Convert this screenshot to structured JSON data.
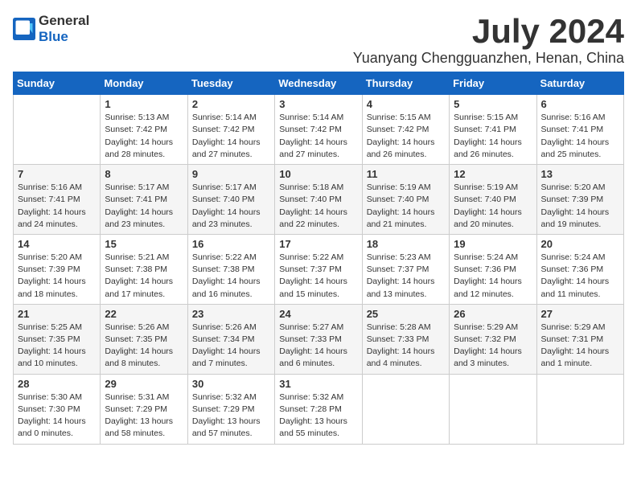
{
  "logo": {
    "general": "General",
    "blue": "Blue"
  },
  "title": "July 2024",
  "subtitle": "Yuanyang Chengguanzhen, Henan, China",
  "weekdays": [
    "Sunday",
    "Monday",
    "Tuesday",
    "Wednesday",
    "Thursday",
    "Friday",
    "Saturday"
  ],
  "weeks": [
    [
      {
        "day": "",
        "sunrise": "",
        "sunset": "",
        "daylight": ""
      },
      {
        "day": "1",
        "sunrise": "5:13 AM",
        "sunset": "7:42 PM",
        "daylight": "14 hours and 28 minutes."
      },
      {
        "day": "2",
        "sunrise": "5:14 AM",
        "sunset": "7:42 PM",
        "daylight": "14 hours and 27 minutes."
      },
      {
        "day": "3",
        "sunrise": "5:14 AM",
        "sunset": "7:42 PM",
        "daylight": "14 hours and 27 minutes."
      },
      {
        "day": "4",
        "sunrise": "5:15 AM",
        "sunset": "7:42 PM",
        "daylight": "14 hours and 26 minutes."
      },
      {
        "day": "5",
        "sunrise": "5:15 AM",
        "sunset": "7:41 PM",
        "daylight": "14 hours and 26 minutes."
      },
      {
        "day": "6",
        "sunrise": "5:16 AM",
        "sunset": "7:41 PM",
        "daylight": "14 hours and 25 minutes."
      }
    ],
    [
      {
        "day": "7",
        "sunrise": "5:16 AM",
        "sunset": "7:41 PM",
        "daylight": "14 hours and 24 minutes."
      },
      {
        "day": "8",
        "sunrise": "5:17 AM",
        "sunset": "7:41 PM",
        "daylight": "14 hours and 23 minutes."
      },
      {
        "day": "9",
        "sunrise": "5:17 AM",
        "sunset": "7:40 PM",
        "daylight": "14 hours and 23 minutes."
      },
      {
        "day": "10",
        "sunrise": "5:18 AM",
        "sunset": "7:40 PM",
        "daylight": "14 hours and 22 minutes."
      },
      {
        "day": "11",
        "sunrise": "5:19 AM",
        "sunset": "7:40 PM",
        "daylight": "14 hours and 21 minutes."
      },
      {
        "day": "12",
        "sunrise": "5:19 AM",
        "sunset": "7:40 PM",
        "daylight": "14 hours and 20 minutes."
      },
      {
        "day": "13",
        "sunrise": "5:20 AM",
        "sunset": "7:39 PM",
        "daylight": "14 hours and 19 minutes."
      }
    ],
    [
      {
        "day": "14",
        "sunrise": "5:20 AM",
        "sunset": "7:39 PM",
        "daylight": "14 hours and 18 minutes."
      },
      {
        "day": "15",
        "sunrise": "5:21 AM",
        "sunset": "7:38 PM",
        "daylight": "14 hours and 17 minutes."
      },
      {
        "day": "16",
        "sunrise": "5:22 AM",
        "sunset": "7:38 PM",
        "daylight": "14 hours and 16 minutes."
      },
      {
        "day": "17",
        "sunrise": "5:22 AM",
        "sunset": "7:37 PM",
        "daylight": "14 hours and 15 minutes."
      },
      {
        "day": "18",
        "sunrise": "5:23 AM",
        "sunset": "7:37 PM",
        "daylight": "14 hours and 13 minutes."
      },
      {
        "day": "19",
        "sunrise": "5:24 AM",
        "sunset": "7:36 PM",
        "daylight": "14 hours and 12 minutes."
      },
      {
        "day": "20",
        "sunrise": "5:24 AM",
        "sunset": "7:36 PM",
        "daylight": "14 hours and 11 minutes."
      }
    ],
    [
      {
        "day": "21",
        "sunrise": "5:25 AM",
        "sunset": "7:35 PM",
        "daylight": "14 hours and 10 minutes."
      },
      {
        "day": "22",
        "sunrise": "5:26 AM",
        "sunset": "7:35 PM",
        "daylight": "14 hours and 8 minutes."
      },
      {
        "day": "23",
        "sunrise": "5:26 AM",
        "sunset": "7:34 PM",
        "daylight": "14 hours and 7 minutes."
      },
      {
        "day": "24",
        "sunrise": "5:27 AM",
        "sunset": "7:33 PM",
        "daylight": "14 hours and 6 minutes."
      },
      {
        "day": "25",
        "sunrise": "5:28 AM",
        "sunset": "7:33 PM",
        "daylight": "14 hours and 4 minutes."
      },
      {
        "day": "26",
        "sunrise": "5:29 AM",
        "sunset": "7:32 PM",
        "daylight": "14 hours and 3 minutes."
      },
      {
        "day": "27",
        "sunrise": "5:29 AM",
        "sunset": "7:31 PM",
        "daylight": "14 hours and 1 minute."
      }
    ],
    [
      {
        "day": "28",
        "sunrise": "5:30 AM",
        "sunset": "7:30 PM",
        "daylight": "14 hours and 0 minutes."
      },
      {
        "day": "29",
        "sunrise": "5:31 AM",
        "sunset": "7:29 PM",
        "daylight": "13 hours and 58 minutes."
      },
      {
        "day": "30",
        "sunrise": "5:32 AM",
        "sunset": "7:29 PM",
        "daylight": "13 hours and 57 minutes."
      },
      {
        "day": "31",
        "sunrise": "5:32 AM",
        "sunset": "7:28 PM",
        "daylight": "13 hours and 55 minutes."
      },
      {
        "day": "",
        "sunrise": "",
        "sunset": "",
        "daylight": ""
      },
      {
        "day": "",
        "sunrise": "",
        "sunset": "",
        "daylight": ""
      },
      {
        "day": "",
        "sunrise": "",
        "sunset": "",
        "daylight": ""
      }
    ]
  ]
}
